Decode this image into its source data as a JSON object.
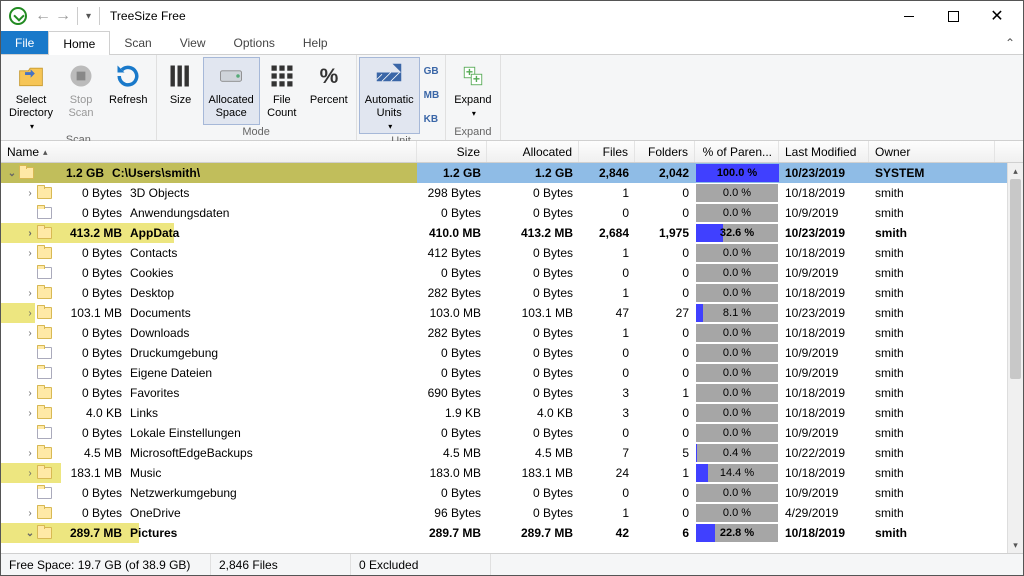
{
  "title": "TreeSize Free",
  "menu": {
    "file": "File",
    "home": "Home",
    "scan": "Scan",
    "view": "View",
    "options": "Options",
    "help": "Help"
  },
  "ribbon": {
    "select_directory": "Select\nDirectory",
    "stop_scan": "Stop\nScan",
    "refresh": "Refresh",
    "scan_group": "Scan",
    "size": "Size",
    "allocated_space": "Allocated\nSpace",
    "file_count": "File\nCount",
    "percent": "Percent",
    "mode_group": "Mode",
    "automatic_units": "Automatic\nUnits",
    "unit_gb": "GB",
    "unit_mb": "MB",
    "unit_kb": "KB",
    "unit_group": "Unit",
    "expand": "Expand",
    "expand_group": "Expand"
  },
  "headers": {
    "name": "Name",
    "size": "Size",
    "allocated": "Allocated",
    "files": "Files",
    "folders": "Folders",
    "pct": "% of Paren...",
    "modified": "Last Modified",
    "owner": "Owner"
  },
  "status": {
    "free": "Free Space: 19.7 GB  (of 38.9 GB)",
    "files": "2,846 Files",
    "excluded": "0 Excluded"
  },
  "rows": [
    {
      "depth": 0,
      "exp": "v",
      "icon": "folder",
      "sizecol": "1.2 GB",
      "name": "C:\\Users\\smith\\",
      "size": "1.2 GB",
      "alloc": "1.2 GB",
      "files": "2,846",
      "folders": "2,042",
      "pct": 100.0,
      "mod": "10/23/2019",
      "owner": "SYSTEM",
      "barColor": "#c1be5b",
      "selected": true,
      "bold": true
    },
    {
      "depth": 1,
      "exp": ">",
      "icon": "folder",
      "sizecol": "0 Bytes",
      "name": "3D Objects",
      "size": "298 Bytes",
      "alloc": "0 Bytes",
      "files": "1",
      "folders": "0",
      "pct": 0.0,
      "mod": "10/18/2019",
      "owner": "smith",
      "barColor": ""
    },
    {
      "depth": 1,
      "exp": "",
      "icon": "junction",
      "sizecol": "0 Bytes",
      "name": "Anwendungsdaten",
      "size": "0 Bytes",
      "alloc": "0 Bytes",
      "files": "0",
      "folders": "0",
      "pct": 0.0,
      "mod": "10/9/2019",
      "owner": "smith",
      "barColor": ""
    },
    {
      "depth": 1,
      "exp": ">",
      "icon": "folder",
      "sizecol": "413.2 MB",
      "name": "AppData",
      "size": "410.0 MB",
      "alloc": "413.2 MB",
      "files": "2,684",
      "folders": "1,975",
      "pct": 32.6,
      "mod": "10/23/2019",
      "owner": "smith",
      "barColor": "#ede680",
      "bold": true
    },
    {
      "depth": 1,
      "exp": ">",
      "icon": "folder",
      "sizecol": "0 Bytes",
      "name": "Contacts",
      "size": "412 Bytes",
      "alloc": "0 Bytes",
      "files": "1",
      "folders": "0",
      "pct": 0.0,
      "mod": "10/18/2019",
      "owner": "smith",
      "barColor": ""
    },
    {
      "depth": 1,
      "exp": "",
      "icon": "junction",
      "sizecol": "0 Bytes",
      "name": "Cookies",
      "size": "0 Bytes",
      "alloc": "0 Bytes",
      "files": "0",
      "folders": "0",
      "pct": 0.0,
      "mod": "10/9/2019",
      "owner": "smith",
      "barColor": ""
    },
    {
      "depth": 1,
      "exp": ">",
      "icon": "folder",
      "sizecol": "0 Bytes",
      "name": "Desktop",
      "size": "282 Bytes",
      "alloc": "0 Bytes",
      "files": "1",
      "folders": "0",
      "pct": 0.0,
      "mod": "10/18/2019",
      "owner": "smith",
      "barColor": ""
    },
    {
      "depth": 1,
      "exp": ">",
      "icon": "folder",
      "sizecol": "103.1 MB",
      "name": "Documents",
      "size": "103.0 MB",
      "alloc": "103.1 MB",
      "files": "47",
      "folders": "27",
      "pct": 8.1,
      "mod": "10/23/2019",
      "owner": "smith",
      "barColor": "#ede680"
    },
    {
      "depth": 1,
      "exp": ">",
      "icon": "folder",
      "sizecol": "0 Bytes",
      "name": "Downloads",
      "size": "282 Bytes",
      "alloc": "0 Bytes",
      "files": "1",
      "folders": "0",
      "pct": 0.0,
      "mod": "10/18/2019",
      "owner": "smith",
      "barColor": ""
    },
    {
      "depth": 1,
      "exp": "",
      "icon": "junction",
      "sizecol": "0 Bytes",
      "name": "Druckumgebung",
      "size": "0 Bytes",
      "alloc": "0 Bytes",
      "files": "0",
      "folders": "0",
      "pct": 0.0,
      "mod": "10/9/2019",
      "owner": "smith",
      "barColor": ""
    },
    {
      "depth": 1,
      "exp": "",
      "icon": "junction",
      "sizecol": "0 Bytes",
      "name": "Eigene Dateien",
      "size": "0 Bytes",
      "alloc": "0 Bytes",
      "files": "0",
      "folders": "0",
      "pct": 0.0,
      "mod": "10/9/2019",
      "owner": "smith",
      "barColor": ""
    },
    {
      "depth": 1,
      "exp": ">",
      "icon": "folder",
      "sizecol": "0 Bytes",
      "name": "Favorites",
      "size": "690 Bytes",
      "alloc": "0 Bytes",
      "files": "3",
      "folders": "1",
      "pct": 0.0,
      "mod": "10/18/2019",
      "owner": "smith",
      "barColor": ""
    },
    {
      "depth": 1,
      "exp": ">",
      "icon": "folder",
      "sizecol": "4.0 KB",
      "name": "Links",
      "size": "1.9 KB",
      "alloc": "4.0 KB",
      "files": "3",
      "folders": "0",
      "pct": 0.0,
      "mod": "10/18/2019",
      "owner": "smith",
      "barColor": ""
    },
    {
      "depth": 1,
      "exp": "",
      "icon": "junction",
      "sizecol": "0 Bytes",
      "name": "Lokale Einstellungen",
      "size": "0 Bytes",
      "alloc": "0 Bytes",
      "files": "0",
      "folders": "0",
      "pct": 0.0,
      "mod": "10/9/2019",
      "owner": "smith",
      "barColor": ""
    },
    {
      "depth": 1,
      "exp": ">",
      "icon": "folder",
      "sizecol": "4.5 MB",
      "name": "MicrosoftEdgeBackups",
      "size": "4.5 MB",
      "alloc": "4.5 MB",
      "files": "7",
      "folders": "5",
      "pct": 0.4,
      "mod": "10/22/2019",
      "owner": "smith",
      "barColor": ""
    },
    {
      "depth": 1,
      "exp": ">",
      "icon": "folder",
      "sizecol": "183.1 MB",
      "name": "Music",
      "size": "183.0 MB",
      "alloc": "183.1 MB",
      "files": "24",
      "folders": "1",
      "pct": 14.4,
      "mod": "10/18/2019",
      "owner": "smith",
      "barColor": "#ede680"
    },
    {
      "depth": 1,
      "exp": "",
      "icon": "junction",
      "sizecol": "0 Bytes",
      "name": "Netzwerkumgebung",
      "size": "0 Bytes",
      "alloc": "0 Bytes",
      "files": "0",
      "folders": "0",
      "pct": 0.0,
      "mod": "10/9/2019",
      "owner": "smith",
      "barColor": ""
    },
    {
      "depth": 1,
      "exp": ">",
      "icon": "folder",
      "sizecol": "0 Bytes",
      "name": "OneDrive",
      "size": "96 Bytes",
      "alloc": "0 Bytes",
      "files": "1",
      "folders": "0",
      "pct": 0.0,
      "mod": "4/29/2019",
      "owner": "smith",
      "barColor": ""
    },
    {
      "depth": 1,
      "exp": "v",
      "icon": "folder",
      "sizecol": "289.7 MB",
      "name": "Pictures",
      "size": "289.7 MB",
      "alloc": "289.7 MB",
      "files": "42",
      "folders": "6",
      "pct": 22.8,
      "mod": "10/18/2019",
      "owner": "smith",
      "barColor": "#ede680",
      "bold": true
    }
  ]
}
